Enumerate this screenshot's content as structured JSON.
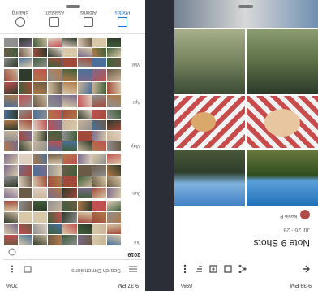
{
  "right_phone": {
    "status": {
      "time": "9:39 PM",
      "battery": "69%"
    },
    "album": {
      "title": "Note 9 Shots",
      "date_range": "Jul 26 - 28",
      "owner": "Kevin R"
    },
    "toolbar_icons": [
      "back-icon",
      "share-icon",
      "add-to-album-icon",
      "photo-add-icon",
      "sort-icon",
      "more-icon"
    ]
  },
  "left_phone": {
    "status": {
      "time": "9:37 PM",
      "battery": "70%"
    },
    "search": {
      "placeholder": "Search Dimensions"
    },
    "timeline": {
      "year": "2019",
      "months": [
        "Jul",
        "Jun",
        "May",
        "Apr",
        "Mar"
      ]
    },
    "bottom_nav": [
      {
        "label": "Photos",
        "icon": "photo-icon",
        "active": true
      },
      {
        "label": "Albums",
        "icon": "album-icon",
        "active": false
      },
      {
        "label": "Assistant",
        "icon": "assistant-icon",
        "active": false
      },
      {
        "label": "Sharing",
        "icon": "sharing-icon",
        "active": false
      }
    ],
    "accent": "#1a73e8"
  }
}
